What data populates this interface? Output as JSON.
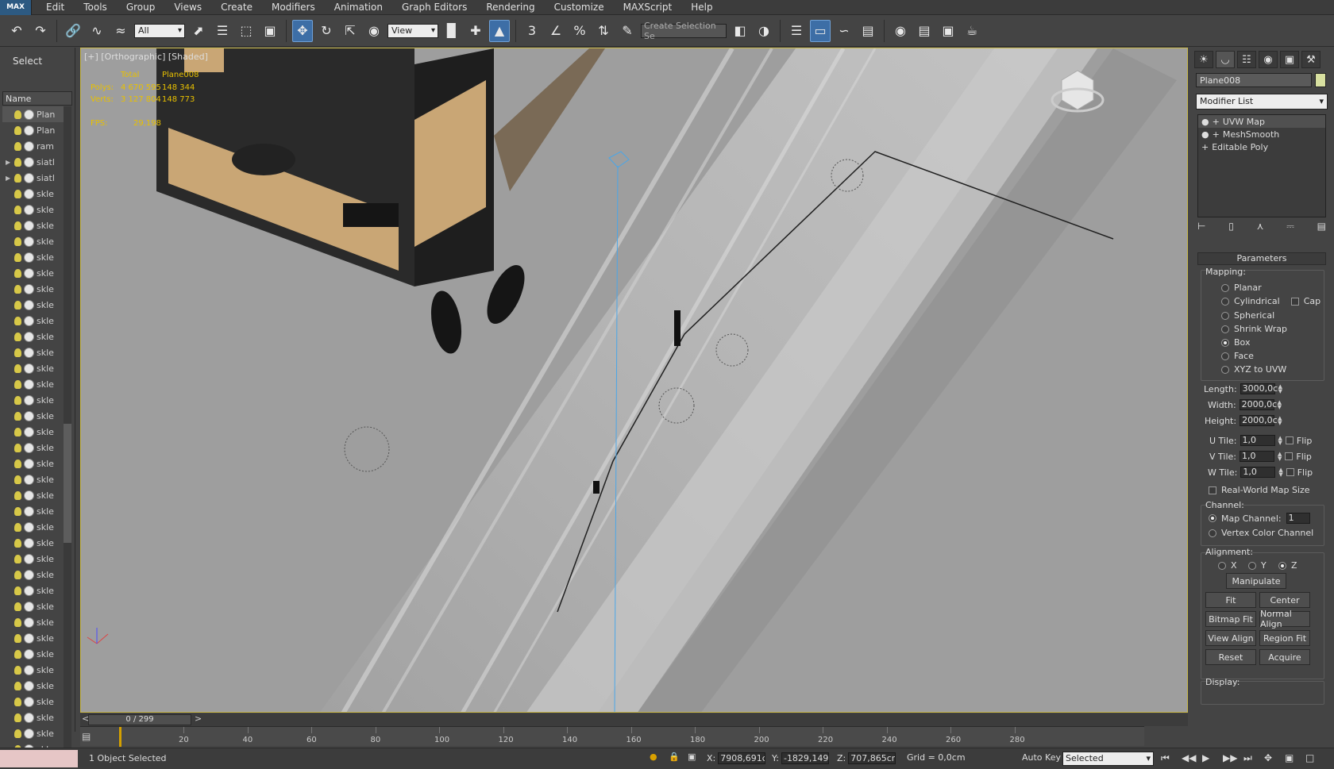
{
  "app": {
    "logo": "MAX"
  },
  "menu": [
    "Edit",
    "Tools",
    "Group",
    "Views",
    "Create",
    "Modifiers",
    "Animation",
    "Graph Editors",
    "Rendering",
    "Customize",
    "MAXScript",
    "Help"
  ],
  "toolbar": {
    "filter_value": "All",
    "refcoord_value": "View",
    "selection_set_placeholder": "Create Selection Se",
    "snap_label": "3"
  },
  "explorer": {
    "header": "Select",
    "column_name": "Name",
    "rows": [
      {
        "label": "Plan",
        "expand": ""
      },
      {
        "label": "Plan",
        "expand": ""
      },
      {
        "label": "ram",
        "expand": ""
      },
      {
        "label": "siatl",
        "expand": "▶"
      },
      {
        "label": "siatl",
        "expand": "▶"
      },
      {
        "label": "skle",
        "expand": ""
      },
      {
        "label": "skle",
        "expand": ""
      },
      {
        "label": "skle",
        "expand": ""
      },
      {
        "label": "skle",
        "expand": ""
      },
      {
        "label": "skle",
        "expand": ""
      },
      {
        "label": "skle",
        "expand": ""
      },
      {
        "label": "skle",
        "expand": ""
      },
      {
        "label": "skle",
        "expand": ""
      },
      {
        "label": "skle",
        "expand": ""
      },
      {
        "label": "skle",
        "expand": ""
      },
      {
        "label": "skle",
        "expand": ""
      },
      {
        "label": "skle",
        "expand": ""
      },
      {
        "label": "skle",
        "expand": ""
      },
      {
        "label": "skle",
        "expand": ""
      },
      {
        "label": "skle",
        "expand": ""
      },
      {
        "label": "skle",
        "expand": ""
      },
      {
        "label": "skle",
        "expand": ""
      },
      {
        "label": "skle",
        "expand": ""
      },
      {
        "label": "skle",
        "expand": ""
      },
      {
        "label": "skle",
        "expand": ""
      },
      {
        "label": "skle",
        "expand": ""
      },
      {
        "label": "skle",
        "expand": ""
      },
      {
        "label": "skle",
        "expand": ""
      },
      {
        "label": "skle",
        "expand": ""
      },
      {
        "label": "skle",
        "expand": ""
      },
      {
        "label": "skle",
        "expand": ""
      },
      {
        "label": "skle",
        "expand": ""
      },
      {
        "label": "skle",
        "expand": ""
      },
      {
        "label": "skle",
        "expand": ""
      },
      {
        "label": "skle",
        "expand": ""
      },
      {
        "label": "skle",
        "expand": ""
      },
      {
        "label": "skle",
        "expand": ""
      },
      {
        "label": "skle",
        "expand": ""
      },
      {
        "label": "skle",
        "expand": ""
      },
      {
        "label": "skle",
        "expand": ""
      },
      {
        "label": "skle",
        "expand": ""
      }
    ]
  },
  "viewport": {
    "label": "[+] [Orthographic] [Shaded]",
    "stats": {
      "total_label": "Total",
      "object_label": "Plane008",
      "polys_label": "Polys:",
      "polys_total": "4 670 595",
      "polys_object": "148 344",
      "verts_label": "Verts:",
      "verts_total": "3 127 804",
      "verts_object": "148 773",
      "fps_label": "FPS:",
      "fps_value": "29,198"
    }
  },
  "command_panel": {
    "object_name": "Plane008",
    "object_color": "#d8e0a0",
    "modifier_list": "Modifier List",
    "stack": [
      "UVW Map",
      "MeshSmooth",
      "Editable Poly"
    ],
    "parameters_title": "Parameters",
    "mapping_label": "Mapping:",
    "mapping_options": [
      "Planar",
      "Cylindrical",
      "Spherical",
      "Shrink Wrap",
      "Box",
      "Face",
      "XYZ to UVW"
    ],
    "mapping_selected": "Box",
    "cap_label": "Cap",
    "length_label": "Length:",
    "length_value": "3000,0c",
    "width_label": "Width:",
    "width_value": "2000,0c",
    "height_label": "Height:",
    "height_value": "2000,0c",
    "utile_label": "U Tile:",
    "utile_value": "1,0",
    "vtile_label": "V Tile:",
    "vtile_value": "1,0",
    "wtile_label": "W Tile:",
    "wtile_value": "1,0",
    "flip_label": "Flip",
    "realworld_label": "Real-World Map Size",
    "channel_label": "Channel:",
    "map_channel_label": "Map Channel:",
    "map_channel_value": "1",
    "vertex_color_label": "Vertex Color Channel",
    "alignment_label": "Alignment:",
    "axis_x": "X",
    "axis_y": "Y",
    "axis_z": "Z",
    "manipulate": "Manipulate",
    "fit": "Fit",
    "center": "Center",
    "bitmap_fit": "Bitmap Fit",
    "normal_align": "Normal Align",
    "view_align": "View Align",
    "region_fit": "Region Fit",
    "reset": "Reset",
    "acquire": "Acquire",
    "display_label": "Display:"
  },
  "timeline": {
    "frame_display": "0 / 299",
    "ticks": [
      "20",
      "40",
      "60",
      "80",
      "100",
      "120",
      "140",
      "160",
      "180",
      "200",
      "220",
      "240",
      "260",
      "280"
    ]
  },
  "status": {
    "message": "1 Object Selected",
    "x_label": "X:",
    "x_value": "7908,691c",
    "y_label": "Y:",
    "y_value": "-1829,149",
    "z_label": "Z:",
    "z_value": "707,865cm",
    "grid": "Grid = 0,0cm",
    "autokey": "Auto Key",
    "selected_dropdown": "Selected"
  }
}
